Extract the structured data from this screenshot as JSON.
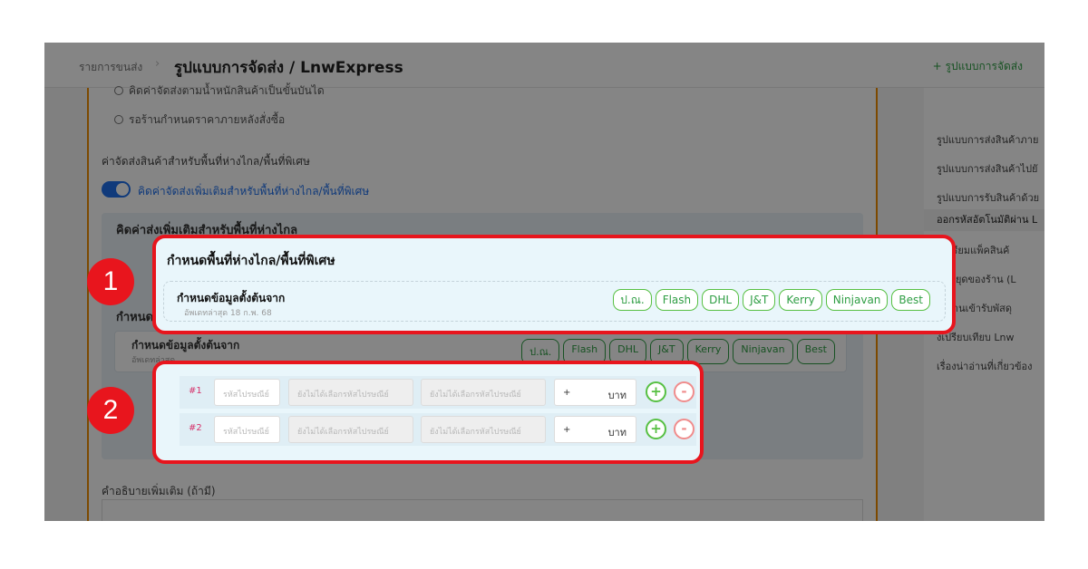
{
  "breadcrumb": {
    "parent": "รายการขนส่ง",
    "separator": "›",
    "title": "รูปแบบการจัดส่ง / LnwExpress"
  },
  "header": {
    "add_label": "+ รูปแบบการจัดส่ง"
  },
  "main": {
    "radio_1": "คิดค่าจัดส่งตามน้ำหนักสินค้าเป็นขั้นบันได",
    "radio_2": "รอร้านกำหนดราคาภายหลังสั่งซื้อ",
    "remote_label": "ค่าจัดส่งสินค้าสำหรับพื้นที่ห่างไกล/พื้นที่พิเศษ",
    "toggle_label": "คิดค่าจัดส่งเพิ่มเติมสำหรับพื้นที่ห่างไกล/พื้นที่พิเศษ",
    "block_title": "คิดค่าส่งเพิ่มเติมสำหรับพื้นที่ห่างไกล",
    "block_sub": "กำหนด",
    "row_title": "กำหนดข้อมูลตั้งต้นจาก",
    "row_sub": "อัพเดทล่าสุด",
    "carriers": [
      "ป.ณ.",
      "Flash",
      "DHL",
      "J&T",
      "Kerry",
      "Ninjavan",
      "Best"
    ],
    "desc_label": "คำอธิบายเพิ่มเติม (ถ้ามี)"
  },
  "sidebar": {
    "items": [
      "รูปแบบการส่งสินค้าภาย",
      "รูปแบบการส่งสินค้าไปยั",
      "รูปแบบการรับสินค้าด้วย",
      "ออกรหัสอัตโนมัติผ่าน L",
      "อเตรียมแพ็คสินค้",
      "วันหยุดของร้าน (L",
      "องร้านเข้ารับพัสดุ",
      "งเปรียบเทียบ Lnw",
      "เรื่องน่าอ่านที่เกี่ยวข้อง"
    ]
  },
  "callout1": {
    "title": "กำหนดพื้นที่ห่างไกล/พื้นที่พิเศษ",
    "row_title": "กำหนดข้อมูลตั้งต้นจาก",
    "row_sub": "อัพเดทล่าสุด 18 ก.พ. 68",
    "chips": [
      "ป.ณ.",
      "Flash",
      "DHL",
      "J&T",
      "Kerry",
      "Ninjavan",
      "Best"
    ]
  },
  "callout2": {
    "rows": [
      {
        "index": "#1",
        "postal_placeholder": "รหัสไปรษณีย์",
        "district_placeholder": "ยังไม่ได้เลือกรหัสไปรษณีย์",
        "subdistrict_placeholder": "ยังไม่ได้เลือกรหัสไปรษณีย์",
        "price_prefix": "+",
        "unit": "บาท",
        "plus": "+",
        "minus": "-"
      },
      {
        "index": "#2",
        "postal_placeholder": "รหัสไปรษณีย์",
        "district_placeholder": "ยังไม่ได้เลือกรหัสไปรษณีย์",
        "subdistrict_placeholder": "ยังไม่ได้เลือกรหัสไปรษณีย์",
        "price_prefix": "+",
        "unit": "บาท",
        "plus": "+",
        "minus": "-"
      }
    ]
  },
  "markers": [
    "1",
    "2"
  ]
}
